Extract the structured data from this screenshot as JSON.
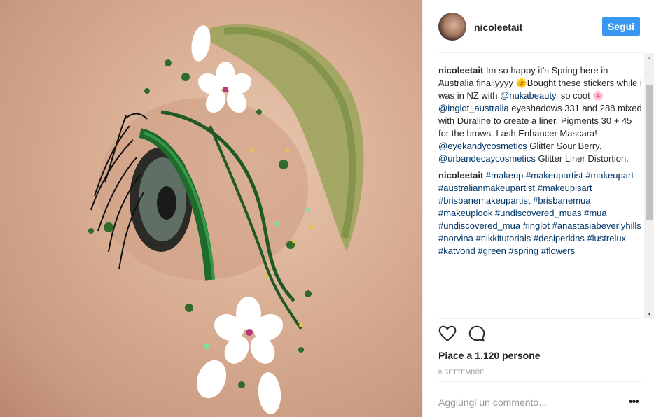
{
  "post": {
    "username": "nicoleetait",
    "follow_label": "Segui",
    "likes_text": "Piace a 1.120 persone",
    "date_text": "8 SETTEMBRE",
    "comment_placeholder": "Aggiungi un commento...",
    "more_label": "•••"
  },
  "caption": {
    "author": "nicoleetait",
    "text_1": "Im so happy it's Spring here in Australia finallyyyy ",
    "emoji_1": "🌞",
    "text_2": "Bought these stickers while i was in NZ with ",
    "mention_1": "@nukabeauty",
    "text_3": ", so coot ",
    "emoji_2": "🌸",
    "mention_2": "@inglot_australia",
    "text_4": " eyeshadows 331 and 288 mixed with Duraline to create a liner. Pigments 30 + 45 for the brows. Lash Enhancer Mascara!",
    "mention_3": "@eyekandycosmetics",
    "text_5": " Glitter Sour Berry.",
    "mention_4": "@urbandecaycosmetics",
    "text_6": " Glitter Liner Distortion."
  },
  "hashtag_comment": {
    "author": "nicoleetait",
    "tags": "#makeup #makeupartist #makeupart #australianmakeupartist #makeupisart #brisbanemakeupartist #brisbanemua #makeuplook #undiscovered_muas #mua #undiscovered_mua #inglot #anastasiabeverlyhills #norvina #nikkitutorials #desiperkins #lustrelux #katvond #green #spring #flowers"
  },
  "scrollbar": {
    "up": "▲",
    "down": "▼"
  },
  "icons": {
    "heart": "heart-icon",
    "comment": "comment-bubble-icon",
    "more": "more-options-icon"
  },
  "colors": {
    "follow": "#3897f0",
    "link": "#003569",
    "muted": "#999999"
  }
}
